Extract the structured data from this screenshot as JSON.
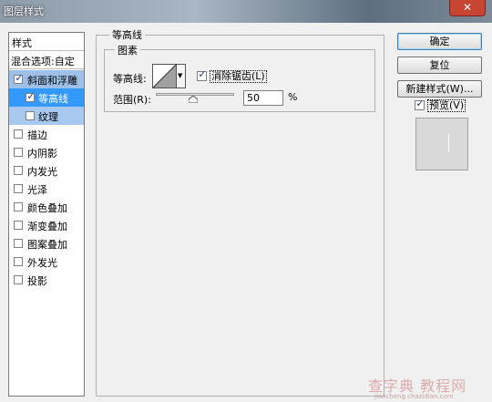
{
  "window": {
    "title": "图层样式",
    "close_label": "✕"
  },
  "styles_panel": {
    "header": "样式",
    "blend_options": "混合选项:自定",
    "items": [
      {
        "label": "斜面和浮雕",
        "checked": true
      },
      {
        "label": "等高线",
        "checked": true
      },
      {
        "label": "纹理",
        "checked": false
      },
      {
        "label": "描边",
        "checked": false
      },
      {
        "label": "内阴影",
        "checked": false
      },
      {
        "label": "内发光",
        "checked": false
      },
      {
        "label": "光泽",
        "checked": false
      },
      {
        "label": "颜色叠加",
        "checked": false
      },
      {
        "label": "渐变叠加",
        "checked": false
      },
      {
        "label": "图案叠加",
        "checked": false
      },
      {
        "label": "外发光",
        "checked": false
      },
      {
        "label": "投影",
        "checked": false
      }
    ]
  },
  "contour_group": {
    "title": "等高线",
    "elements_title": "图素",
    "contour_label": "等高线:",
    "anti_alias_label": "消除锯齿(L)",
    "anti_alias_checked": true,
    "range_label": "范围(R):",
    "range_value": "50",
    "range_unit": "%"
  },
  "buttons": {
    "ok": "确定",
    "reset": "复位",
    "new_style": "新建样式(W)...",
    "preview_label": "预览(V)",
    "preview_checked": true
  },
  "watermark": {
    "text": "查字典 教程网",
    "url": "jiaocheng.chazidian.com"
  },
  "colors": {
    "selected_blue": "#3399ff",
    "selected_light": "#9cc0e8",
    "title_bar": "#8d9aa8"
  }
}
